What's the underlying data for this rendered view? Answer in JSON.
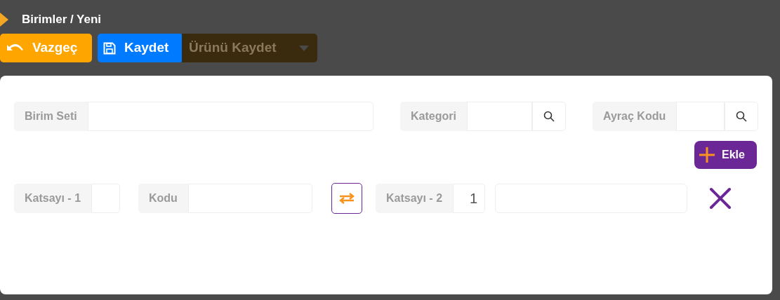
{
  "title": "Birimler / Yeni",
  "toolbar": [
    {
      "label": "Vazgeç",
      "kind": "cancel"
    },
    {
      "label": "Kaydet",
      "kind": "save"
    },
    {
      "label": "Ürünü Kaydet",
      "kind": "dimmed"
    }
  ],
  "header_fields": [
    {
      "label": "Birim Seti",
      "kind": "text"
    },
    {
      "label": "Kategori",
      "kind": "search"
    },
    {
      "label": "Ayraç Kodu",
      "kind": "search"
    }
  ],
  "add_button": {
    "label": "Ekle"
  },
  "unit_row": [
    {
      "kind": "field",
      "label": "Katsayı - 1"
    },
    {
      "kind": "field",
      "label": "Kodu"
    },
    {
      "kind": "swap"
    },
    {
      "kind": "field",
      "label": "Katsayı - 2",
      "value": "1"
    },
    {
      "kind": "input"
    },
    {
      "kind": "remove"
    }
  ]
}
